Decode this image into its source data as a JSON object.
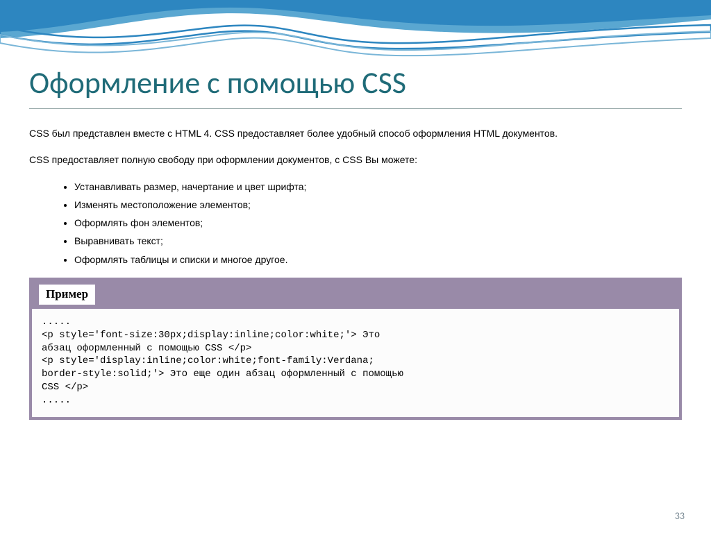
{
  "title": "Оформление с помощью CSS",
  "intro1": "CSS был представлен вместе с HTML 4. CSS предоставляет более удобный способ оформления HTML документов.",
  "intro2": "CSS предоставляет полную свободу при оформлении документов, с CSS Вы можете:",
  "bullets": [
    "Устанавливать размер, начертание и цвет шрифта;",
    "Изменять местоположение элементов;",
    "Оформлять фон элементов;",
    "Выравнивать текст;",
    "Оформлять таблицы и списки и многое другое."
  ],
  "example": {
    "label": "Пример",
    "line1": ".....",
    "line2": "<p style='font-size:30px;display:inline;color:white;'> Это",
    "line3": "абзац оформленный с помощью CSS </p>",
    "line4": "<p style='display:inline;color:white;font-family:Verdana;",
    "line5": "border-style:solid;'> Это еще один абзац оформленный с помощью",
    "line6": "CSS </p>",
    "line7": "....."
  },
  "page_number": "33"
}
